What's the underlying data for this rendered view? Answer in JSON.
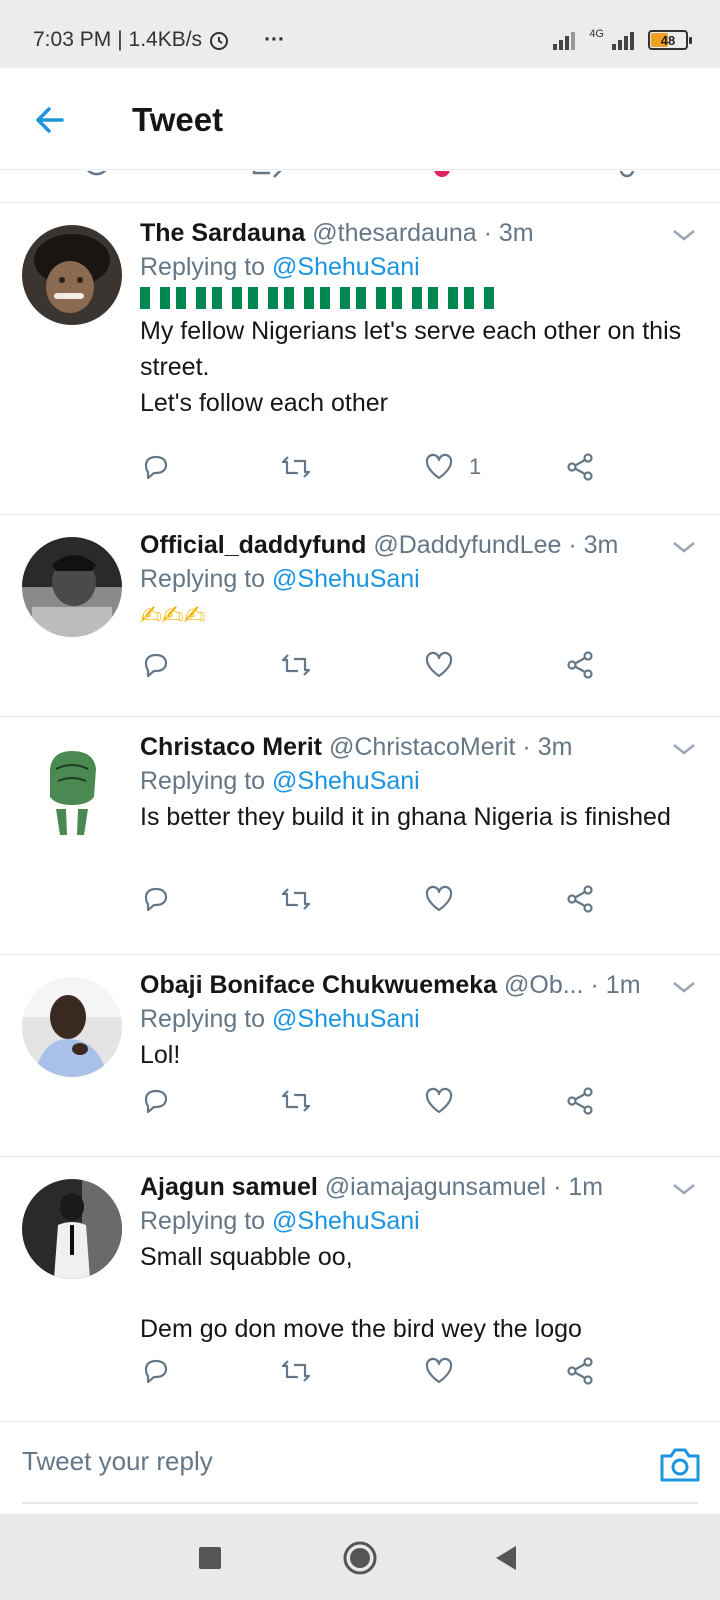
{
  "status_bar": {
    "time": "7:03 PM",
    "speed": "| 1.4KB/s",
    "dots": "···",
    "network": "4G",
    "battery": "48"
  },
  "app_bar": {
    "title": "Tweet"
  },
  "tweets": [
    {
      "name": "The Sardauna",
      "handle": "@thesardauna",
      "time": "· 3m",
      "replying_prefix": "Replying to",
      "replying_to": "@ShehuSani",
      "text": "My fellow Nigerians let's serve each other on this street.\nLet's follow each other",
      "likes": "1"
    },
    {
      "name": "Official_daddyfund",
      "handle": "@DaddyfundLee",
      "time": "· 3m",
      "replying_prefix": "Replying to",
      "replying_to": "@ShehuSani",
      "text": "✍✍✍",
      "likes": ""
    },
    {
      "name": "Christaco Merit",
      "handle": "@ChristacoMerit",
      "time": "· 3m",
      "replying_prefix": "Replying to",
      "replying_to": "@ShehuSani",
      "text": "Is better they build it in ghana Nigeria is finished",
      "likes": ""
    },
    {
      "name": "Obaji Boniface Chukwuemeka",
      "handle": "@Ob...",
      "time": "· 1m",
      "replying_prefix": "Replying to",
      "replying_to": "@ShehuSani",
      "text": "Lol!",
      "likes": ""
    },
    {
      "name": "Ajagun samuel",
      "handle": "@iamajagunsamuel",
      "time": "· 1m",
      "replying_prefix": "Replying to",
      "replying_to": "@ShehuSani",
      "text": "Small squabble oo,\n\nDem go don move the bird wey the logo",
      "likes": ""
    }
  ],
  "compose": {
    "placeholder": "Tweet your reply"
  },
  "colors": {
    "accent": "#1b95e0",
    "text": "#14171a",
    "muted": "#657786",
    "flag_green": "#008751"
  },
  "icons": [
    "back-arrow-icon",
    "chevron-down-icon",
    "reply-icon",
    "retweet-icon",
    "like-icon",
    "share-icon",
    "camera-icon",
    "nav-recents-icon",
    "nav-home-icon",
    "nav-back-icon"
  ]
}
